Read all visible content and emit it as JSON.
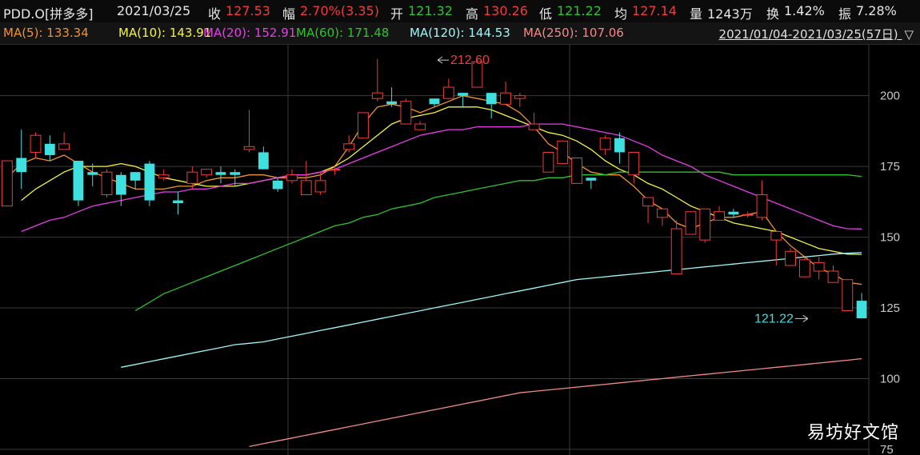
{
  "header": {
    "symbol": "PDD.O[拼多多]",
    "date": "2021/03/25",
    "close_label": "收",
    "close": "127.53",
    "change_label": "幅",
    "change": "2.70%(3.35)",
    "open_label": "开",
    "open": "121.32",
    "high_label": "高",
    "high": "130.26",
    "low_label": "低",
    "low": "121.22",
    "avg_label": "均",
    "avg": "127.14",
    "volume_label": "量",
    "volume": "1243万",
    "turnover_label": "换",
    "turnover": "1.42%",
    "amplitude_label": "振",
    "amplitude": "7.28%"
  },
  "ma_legend": [
    {
      "label": "MA(5): 133.34",
      "color": "#f0922e"
    },
    {
      "label": "MA(10): 143.91",
      "color": "#f5f53b"
    },
    {
      "label": "MA(20): 152.91",
      "color": "#e93ce9"
    },
    {
      "label": "MA(60): 171.48",
      "color": "#2fc32f"
    },
    {
      "label": "MA(120): 144.53",
      "color": "#9ef6f8"
    },
    {
      "label": "MA(250): 107.06",
      "color": "#f28a8a"
    }
  ],
  "date_range": "2021/01/04-2021/03/25(57日)",
  "dropdown_icon": "triangle-down-icon",
  "watermark": "易坊好文馆",
  "colors": {
    "up": "#f23b3b",
    "down": "#3ee0e0",
    "grid": "#3a3a3a",
    "axis_text": "#c8c8c8"
  },
  "chart_data": {
    "type": "candlestick",
    "x": "trading days 2021/01/04-2021/03/25 (57 days)",
    "ylim": [
      73,
      218
    ],
    "y_ticks": [
      75,
      100,
      125,
      150,
      175,
      200
    ],
    "annotations": [
      {
        "text": "212.60",
        "day": 30,
        "value": 212.6
      },
      {
        "text": "121.22",
        "day": 56,
        "value": 121.22
      }
    ],
    "candles": [
      [
        161,
        177,
        161,
        177
      ],
      [
        178,
        173,
        167,
        188
      ],
      [
        180,
        186,
        178,
        187
      ],
      [
        183,
        179,
        177,
        186
      ],
      [
        181,
        183,
        182,
        187
      ],
      [
        177,
        163,
        161,
        173
      ],
      [
        173,
        172,
        168,
        176
      ],
      [
        165,
        173,
        164,
        174
      ],
      [
        172,
        165,
        161,
        173
      ],
      [
        173,
        170,
        167,
        173
      ],
      [
        176,
        163,
        161,
        177
      ],
      [
        171,
        172,
        170,
        174
      ],
      [
        163,
        162,
        158,
        166
      ],
      [
        169,
        173,
        167,
        175
      ],
      [
        172,
        174,
        171,
        174
      ],
      [
        173,
        172,
        169,
        175
      ],
      [
        173,
        172,
        168,
        174
      ],
      [
        181,
        182,
        180,
        195
      ],
      [
        180,
        174,
        174,
        182
      ],
      [
        170,
        167,
        166,
        171
      ],
      [
        170,
        172,
        169,
        174
      ],
      [
        165,
        170,
        168,
        177
      ],
      [
        166,
        170,
        165,
        173
      ],
      [
        174,
        174,
        172,
        175
      ],
      [
        181,
        183,
        180,
        186
      ],
      [
        185,
        194,
        185,
        194
      ],
      [
        199,
        201,
        198,
        213
      ],
      [
        198,
        197,
        196,
        203
      ],
      [
        190,
        198,
        190,
        199
      ],
      [
        188,
        190,
        189,
        191
      ],
      [
        199,
        197,
        196,
        199
      ],
      [
        199,
        203,
        201,
        206
      ],
      [
        201,
        200,
        196,
        201
      ],
      [
        203,
        212,
        203,
        213
      ],
      [
        201,
        197,
        192,
        200
      ],
      [
        197,
        201,
        197,
        205
      ],
      [
        199,
        200,
        196,
        201
      ],
      [
        188,
        190,
        188,
        194
      ],
      [
        173,
        180,
        173,
        180
      ],
      [
        176,
        184,
        178,
        184
      ],
      [
        169,
        178,
        169,
        178
      ],
      [
        171,
        170,
        167,
        171
      ],
      [
        181,
        185,
        179,
        186
      ],
      [
        185,
        180,
        176,
        187
      ],
      [
        172,
        180,
        169,
        180
      ],
      [
        161,
        164,
        155,
        163
      ],
      [
        157,
        160,
        154,
        160
      ],
      [
        137,
        153,
        137,
        156
      ],
      [
        151,
        159,
        151,
        159
      ],
      [
        149,
        160,
        148,
        160
      ],
      [
        156,
        159,
        157,
        161
      ],
      [
        159,
        158,
        157,
        160
      ],
      [
        158,
        158,
        157,
        159
      ],
      [
        157,
        165,
        156,
        170
      ],
      [
        149,
        152,
        140,
        152
      ],
      [
        140,
        145,
        140,
        146
      ],
      [
        136,
        142,
        136,
        143
      ],
      [
        138,
        141,
        135,
        143
      ],
      [
        134,
        138,
        134,
        140
      ],
      [
        124,
        135,
        124,
        135
      ],
      [
        127.53,
        121.32,
        121.22,
        130.26
      ]
    ],
    "series": [
      {
        "name": "MA(5)",
        "color": "#f0922e",
        "values": [
          171,
          176,
          178,
          177,
          179,
          176,
          173,
          171,
          169,
          167,
          167,
          167,
          168,
          168,
          170,
          171,
          171,
          172,
          172,
          171,
          171,
          171,
          172,
          175,
          182,
          190,
          196,
          197,
          196,
          194,
          196,
          198,
          200,
          199,
          198,
          197,
          194,
          189,
          183,
          180,
          176,
          173,
          172,
          172,
          168,
          163,
          160,
          155,
          153,
          155,
          157,
          157,
          158,
          159,
          152,
          147,
          143,
          139,
          137,
          134,
          133.34
        ]
      },
      {
        "name": "MA(10)",
        "color": "#f5f53b",
        "values": [
          163,
          167,
          170,
          173,
          175,
          175,
          175,
          176,
          175,
          173,
          171,
          170,
          169,
          168,
          168,
          168,
          169,
          170,
          171,
          172,
          172,
          173,
          175,
          178,
          182,
          186,
          190,
          192,
          193,
          194,
          196,
          196,
          196,
          195,
          193,
          191,
          189,
          187,
          186,
          184,
          181,
          177,
          174,
          172,
          169,
          167,
          164,
          161,
          159,
          157,
          155,
          154,
          153,
          152,
          150,
          148,
          146,
          145,
          144,
          143.91
        ]
      },
      {
        "name": "MA(20)",
        "color": "#e93ce9",
        "values": [
          152,
          154,
          156,
          157,
          159,
          161,
          162,
          163,
          164,
          165,
          166,
          166,
          167,
          167,
          168,
          169,
          169,
          170,
          171,
          172,
          172,
          173,
          174,
          176,
          178,
          180,
          182,
          184,
          186,
          187,
          188,
          188,
          189,
          189,
          189,
          189,
          190,
          190,
          190,
          189,
          188,
          187,
          186,
          184,
          182,
          179,
          177,
          175,
          172,
          170,
          168,
          166,
          164,
          162,
          160,
          158,
          156,
          154,
          153,
          152.91
        ]
      },
      {
        "name": "MA(60)",
        "color": "#2fc32f",
        "values": [
          124,
          127,
          130,
          132,
          134,
          136,
          138,
          140,
          142,
          144,
          146,
          148,
          150,
          152,
          154,
          155,
          157,
          158,
          160,
          161,
          162,
          164,
          165,
          166,
          167,
          168,
          169,
          170,
          170,
          171,
          171,
          172,
          172,
          172,
          173,
          173,
          173,
          173,
          173,
          173,
          173,
          173,
          172,
          172,
          172,
          172,
          172,
          172,
          172,
          172,
          172,
          171.48
        ]
      },
      {
        "name": "MA(120)",
        "color": "#9ef6f8",
        "values": [
          104,
          105,
          106,
          107,
          108,
          109,
          110,
          111,
          112,
          112.5,
          113,
          114,
          115,
          116,
          117,
          118,
          119,
          120,
          121,
          122,
          123,
          124,
          125,
          126,
          127,
          128,
          129,
          130,
          131,
          132,
          133,
          134,
          135,
          135.5,
          136,
          136.5,
          137,
          137.5,
          138,
          138.5,
          139,
          139.5,
          140,
          140.5,
          141,
          141.5,
          142,
          142.5,
          143,
          143.5,
          144,
          144.3,
          144.53
        ]
      },
      {
        "name": "MA(250)",
        "color": "#f28a8a",
        "values": [
          76,
          77,
          78,
          79,
          80,
          81,
          82,
          83,
          84,
          85,
          86,
          87,
          88,
          89,
          90,
          91,
          92,
          93,
          94,
          95,
          95.5,
          96,
          96.5,
          97,
          97.5,
          98,
          98.5,
          99,
          99.5,
          100,
          100.5,
          101,
          101.5,
          102,
          102.5,
          103,
          103.5,
          104,
          104.5,
          105,
          105.5,
          106,
          106.5,
          107.06
        ]
      }
    ]
  }
}
